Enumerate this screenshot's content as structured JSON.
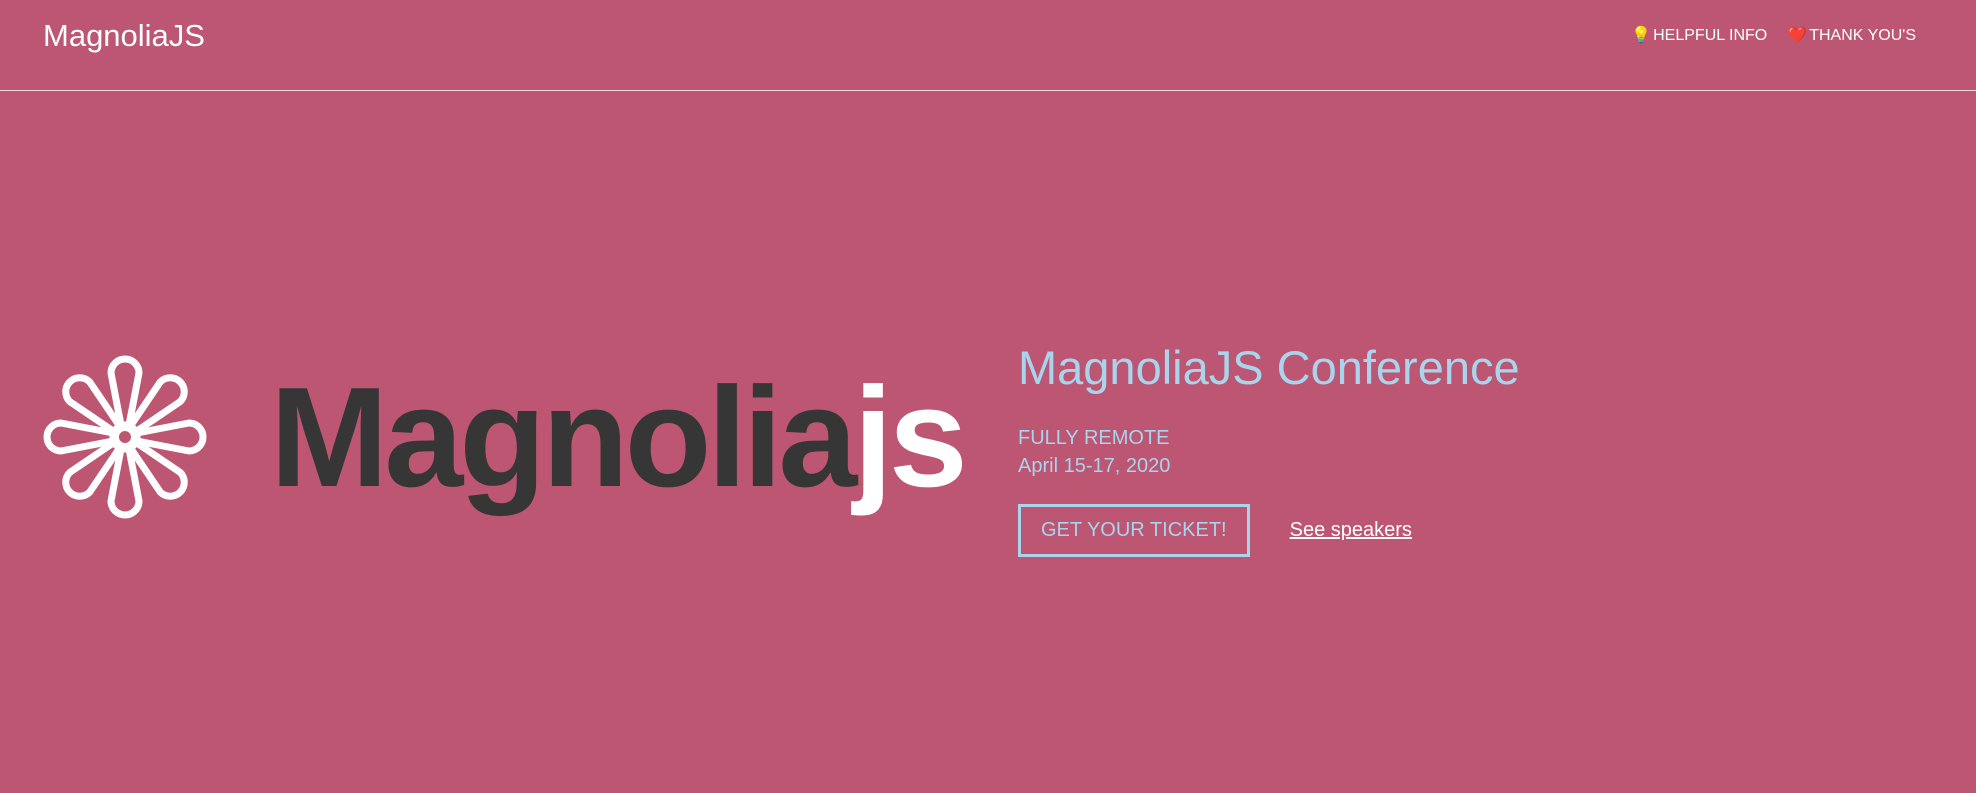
{
  "header": {
    "brand": "MagnoliaJS",
    "nav": [
      {
        "icon": "lightbulb-icon",
        "glyph": "💡",
        "label": "HELPFUL INFO"
      },
      {
        "icon": "heart-icon",
        "glyph": "❤️",
        "label": "THANK YOU'S"
      }
    ]
  },
  "hero": {
    "logo_word_dark": "Magnolia",
    "logo_word_light": "js",
    "title": "MagnoliaJS Conference",
    "location": "FULLY REMOTE",
    "dates": "April 15-17, 2020",
    "ticket_button": "GET YOUR TICKET!",
    "speakers_link": "See speakers"
  },
  "colors": {
    "background": "#bd5672",
    "accent": "#a8d4ec",
    "logo_dark": "#363636",
    "white": "#ffffff"
  }
}
